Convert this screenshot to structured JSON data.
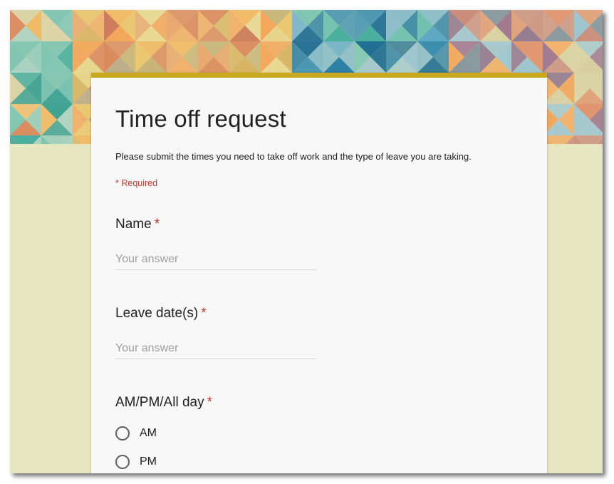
{
  "form": {
    "title": "Time off request",
    "description": "Please submit the times you need to take off work and the type of leave you are taking.",
    "required_note": "* Required",
    "star": "*",
    "questions": [
      {
        "label": "Name",
        "placeholder": "Your answer"
      },
      {
        "label": "Leave date(s)",
        "placeholder": "Your answer"
      },
      {
        "label": "AM/PM/All day",
        "options": [
          "AM",
          "PM"
        ]
      }
    ]
  },
  "colors": {
    "accent_bar": "#c9a820",
    "required_red": "#c5392c",
    "page_background": "#e6e7c0"
  },
  "header": {
    "image": "geometric-triangle-pattern"
  }
}
